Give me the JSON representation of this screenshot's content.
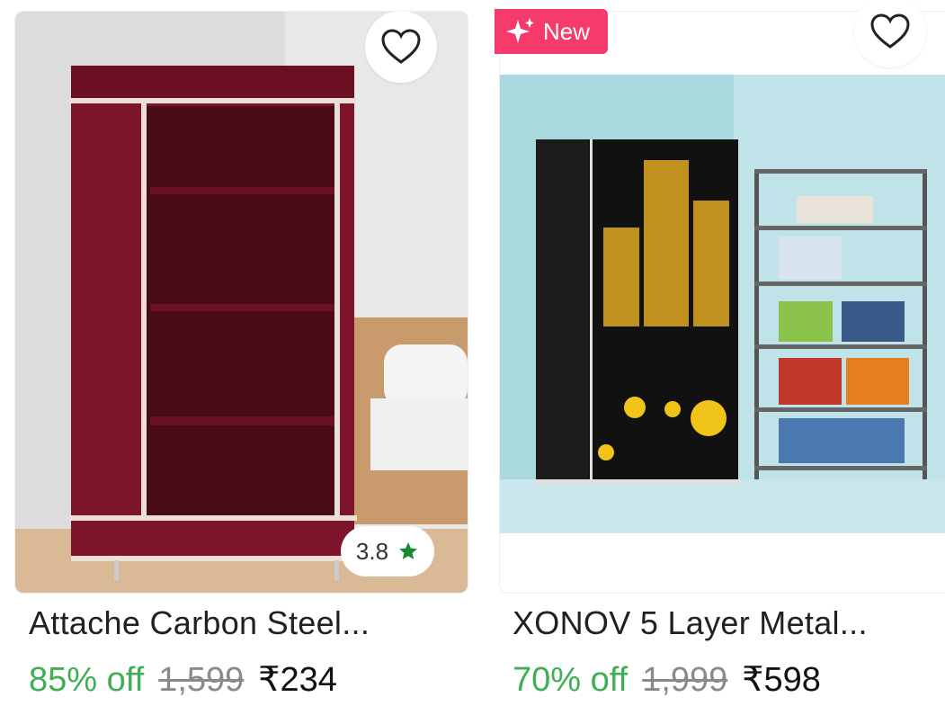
{
  "products": [
    {
      "title": "Attache Carbon Steel...",
      "discount": "85% off",
      "mrp": "1,599",
      "price": "₹234",
      "rating": "3.8"
    },
    {
      "badge": "New",
      "title": "XONOV 5 Layer Metal...",
      "discount": "70% off",
      "mrp": "1,999",
      "price": "₹598"
    }
  ],
  "colors": {
    "discount": "#3fae55",
    "badge": "#f53b6b",
    "rating_star": "#1a8a2e"
  },
  "icons": [
    "heart-icon",
    "star-icon",
    "sparkle-icon"
  ]
}
